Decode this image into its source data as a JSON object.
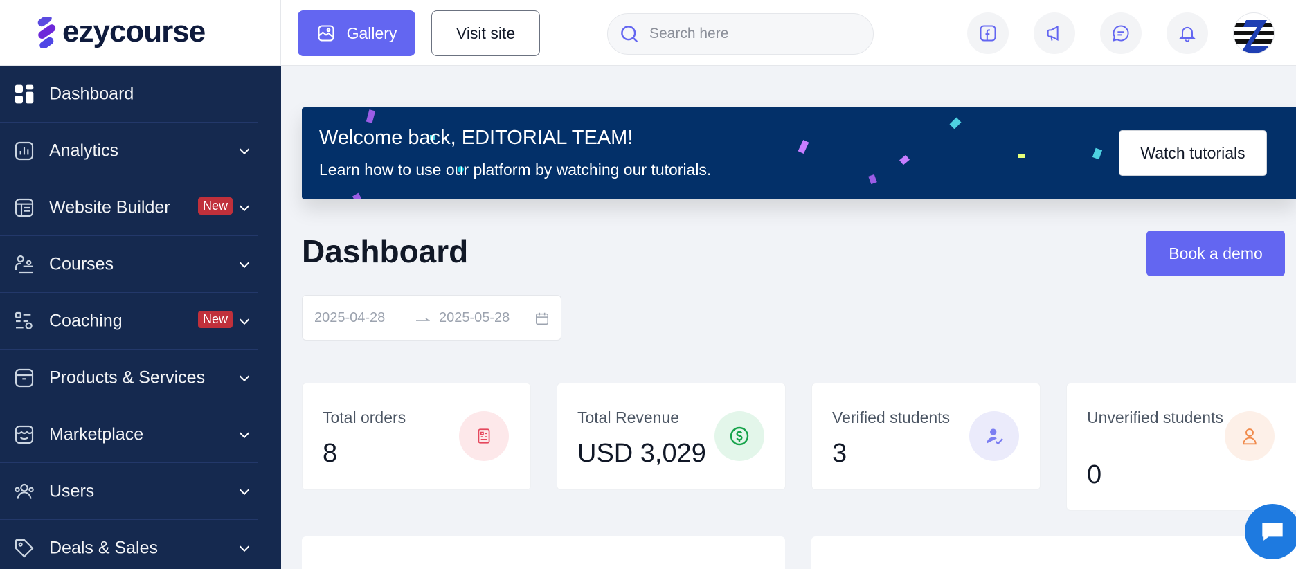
{
  "brand": {
    "name": "ezycourse",
    "color": "#6366f1"
  },
  "header": {
    "gallery_label": "Gallery",
    "visit_label": "Visit site",
    "search_placeholder": "Search here",
    "icons": [
      "facebook-icon",
      "megaphone-icon",
      "chat-icon",
      "bell-icon"
    ]
  },
  "sidebar": {
    "items": [
      {
        "label": "Dashboard",
        "icon": "dashboard-grid-icon",
        "has_chevron": false
      },
      {
        "label": "Analytics",
        "icon": "analytics-icon",
        "has_chevron": true
      },
      {
        "label": "Website Builder",
        "icon": "website-builder-icon",
        "has_chevron": true,
        "badge": "New"
      },
      {
        "label": "Courses",
        "icon": "courses-icon",
        "has_chevron": true
      },
      {
        "label": "Coaching",
        "icon": "coaching-icon",
        "has_chevron": true,
        "badge": "New"
      },
      {
        "label": "Products & Services",
        "icon": "box-icon",
        "has_chevron": true
      },
      {
        "label": "Marketplace",
        "icon": "store-icon",
        "has_chevron": true
      },
      {
        "label": "Users",
        "icon": "users-icon",
        "has_chevron": true
      },
      {
        "label": "Deals & Sales",
        "icon": "tag-icon",
        "has_chevron": true
      }
    ]
  },
  "welcome": {
    "title": "Welcome back, EDITORIAL TEAM!",
    "subtitle": "Learn how to use our platform by watching our tutorials.",
    "button_label": "Watch tutorials"
  },
  "page": {
    "title": "Dashboard",
    "demo_label": "Book a demo"
  },
  "date_range": {
    "start": "2025-04-28",
    "end": "2025-05-28"
  },
  "stats": [
    {
      "label": "Total orders",
      "value": "8",
      "icon": "receipt-icon",
      "icon_bg": "#fde8ea",
      "icon_color": "#e5485d"
    },
    {
      "label": "Total Revenue",
      "value": "USD 3,029",
      "icon": "dollar-icon",
      "icon_bg": "#e3f6ea",
      "icon_color": "#16a34a"
    },
    {
      "label": "Verified students",
      "value": "3",
      "icon": "verified-user-icon",
      "icon_bg": "#ebebfb",
      "icon_color": "#6366f1"
    },
    {
      "label": "Unverified students",
      "value": "0",
      "icon": "user-icon",
      "icon_bg": "#fdf0e8",
      "icon_color": "#f08a4b"
    }
  ]
}
